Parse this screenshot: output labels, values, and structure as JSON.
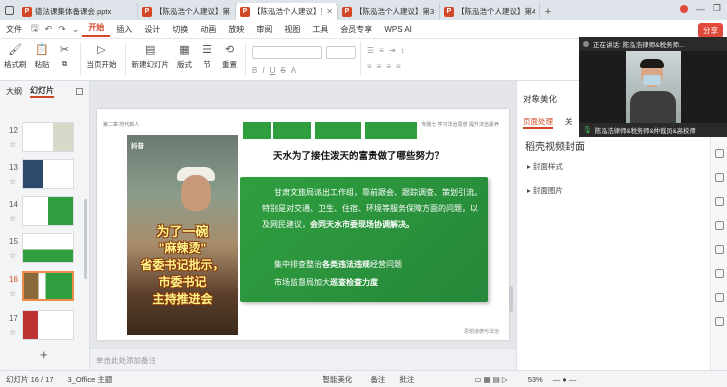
{
  "tabs": [
    {
      "label": "德法课集体备课会.pptx",
      "active": false
    },
    {
      "label": "【陈泓浩个人建议】第1",
      "active": false
    },
    {
      "label": "【陈泓浩个人建议】第",
      "active": true
    },
    {
      "label": "【陈泓浩个人建议】第3",
      "active": false
    },
    {
      "label": "【陈泓浩个人建议】第4",
      "active": false
    }
  ],
  "menu": {
    "file": "文件",
    "items": [
      "开始",
      "插入",
      "设计",
      "切换",
      "动画",
      "放映",
      "审阅",
      "视图",
      "工具",
      "会员专享"
    ],
    "active": "开始",
    "wps_ai": "WPS AI",
    "share": "分享"
  },
  "ribbon": {
    "format_painter": "格式刷",
    "paste": "粘贴",
    "play_current": "当页开始",
    "new_slide": "新建幻灯片",
    "layout": "版式",
    "section": "节",
    "reset": "重置"
  },
  "left_panel": {
    "tab_outline": "大纲",
    "tab_slides": "幻灯片",
    "thumbs": [
      "12",
      "13",
      "14",
      "15",
      "16",
      "17"
    ],
    "selected": "16"
  },
  "slide": {
    "tag": "第二章 时代新人",
    "header_right": "专题七 学习法治思想  提升法治素养",
    "question": "天水为了接住泼天的富贵做了哪些努力？",
    "photo_top": "抖音",
    "photo_caption": [
      "为了一碗",
      "\"麻辣烫\"",
      "省委书记批示，",
      "市委书记",
      "主持推进会"
    ],
    "para1": "甘肃文旅局派出工作组，靠前跟会、跟踪调查、策划引流。特别是对交通、卫生、住宿、环境等服务保障方面的问题，以及网民建议，",
    "para1_bold": "会同天水市委现场协调解决。",
    "line2_pre": "集中排查整治",
    "line2_bold": "各类违法违规",
    "line2_post": "经营问题",
    "line3_pre": "市场监督局加大",
    "line3_bold": "巡查检查力度",
    "footer": "思想道德与法治"
  },
  "notes_placeholder": "单击此处添加备注",
  "right_panel": {
    "header": "对象美化",
    "tab1": "页面处理",
    "tab2": "关",
    "title": "稻壳视频封面",
    "item1": "封面样式",
    "item2": "封面图片"
  },
  "meeting": {
    "speaking_label": "正在讲话: 陈泓浩律师&税务师...",
    "participant": "陈泓浩律师&税务师&仲裁员&高校师"
  },
  "status": {
    "slide_count": "幻灯片 16 / 17",
    "theme": "3_Office 主题",
    "beautify": "智能美化",
    "notes": "备注",
    "comments": "批注",
    "zoom": "53%"
  },
  "colors": {
    "accent": "#d24726",
    "slide_green": "#2e9e3e",
    "selected_thumb": "#f08c4a"
  }
}
